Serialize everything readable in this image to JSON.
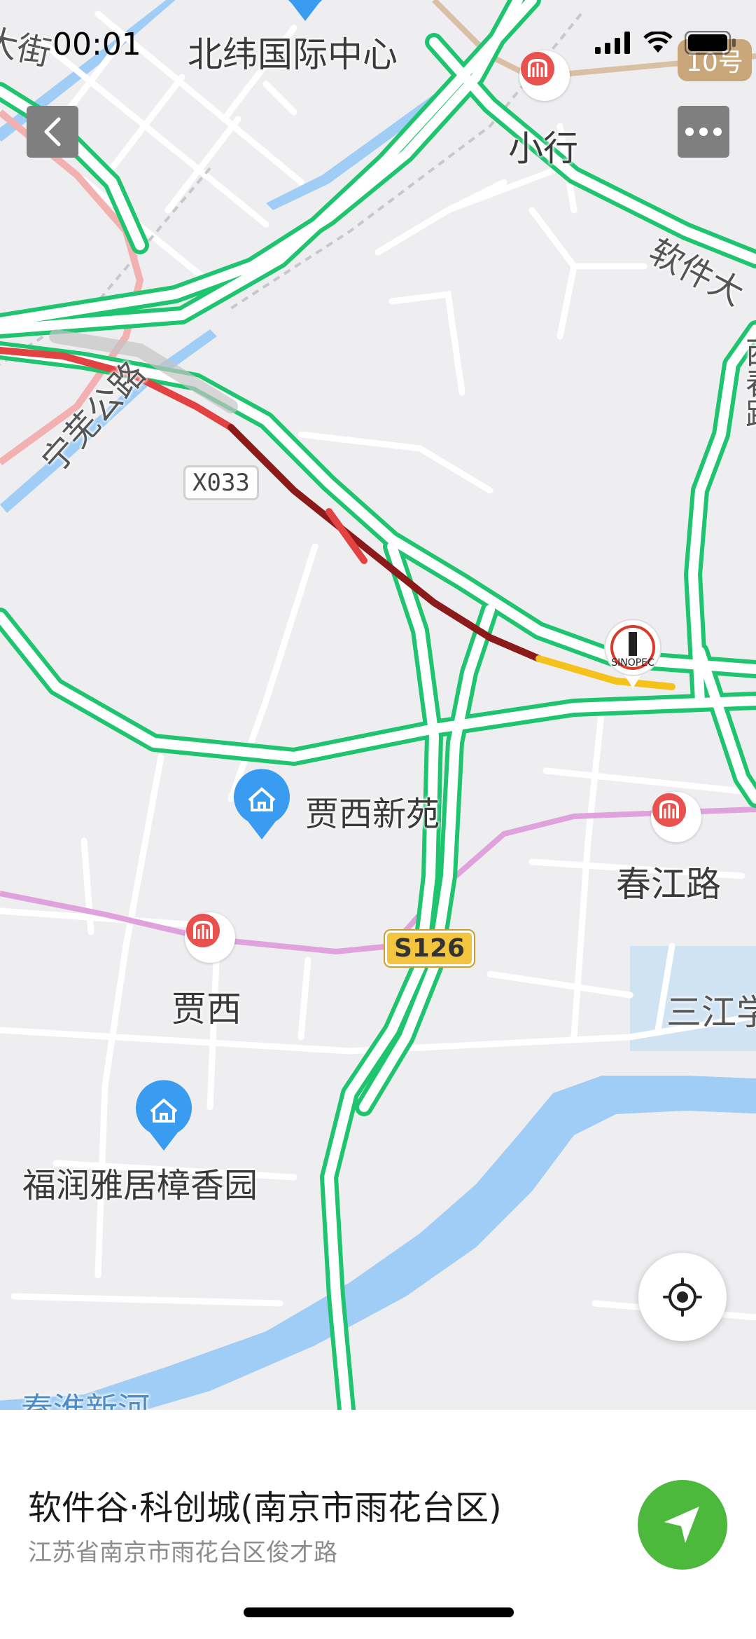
{
  "status_bar": {
    "time": "00:01"
  },
  "map": {
    "station_labels": [
      "北纬国际中心",
      "小行",
      "春江路",
      "贾西"
    ],
    "poi_labels": [
      "贾西新苑",
      "福润雅居樟香园"
    ],
    "road_labels": [
      "宁芜公路",
      "软件大",
      "西春路",
      "大街",
      "三江学",
      "秦淮新河"
    ],
    "road_badges": [
      "X033",
      "S126"
    ],
    "metro_badge": "10号",
    "poi_icons": [
      "residential-area-icon",
      "metro-station-icon",
      "sinopec-gas-station-icon"
    ]
  },
  "controls": {
    "back_icon": "chevron-left-icon",
    "more_icon": "more-dots-icon",
    "locate_icon": "locate-crosshair-icon",
    "navigate_icon": "navigation-arrow-icon"
  },
  "place": {
    "name": "软件谷·科创城(南京市雨花台区)",
    "address": "江苏省南京市雨花台区俊才路"
  },
  "colors": {
    "map_background": "#eeeef1",
    "road_green": "#1ec46e",
    "traffic_red": "#e24242",
    "traffic_darkred": "#8b1a1a",
    "traffic_yellow": "#f4c21b",
    "metro_line_pink": "#e0a2dc",
    "water_blue": "#9fcdf6",
    "nav_button": "#4cb93c"
  }
}
